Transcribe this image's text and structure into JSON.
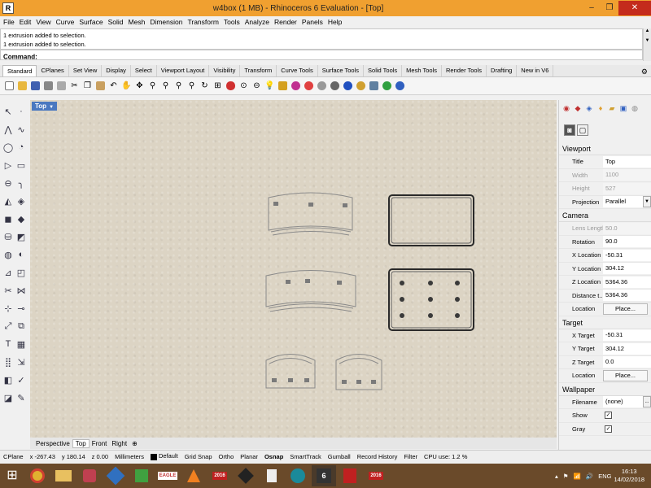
{
  "window": {
    "title": "w4box (1 MB) - Rhinoceros 6 Evaluation - [Top]",
    "minimize_glyph": "–",
    "restore_glyph": "❐",
    "close_glyph": "✕"
  },
  "menu": [
    "File",
    "Edit",
    "View",
    "Curve",
    "Surface",
    "Solid",
    "Mesh",
    "Dimension",
    "Transform",
    "Tools",
    "Analyze",
    "Render",
    "Panels",
    "Help"
  ],
  "command": {
    "history": [
      "1 extrusion added to selection.",
      "1 extrusion added to selection."
    ],
    "prompt": "Command:",
    "value": ""
  },
  "toolbar_tabs": [
    "Standard",
    "CPlanes",
    "Set View",
    "Display",
    "Select",
    "Viewport Layout",
    "Visibility",
    "Transform",
    "Curve Tools",
    "Surface Tools",
    "Solid Tools",
    "Mesh Tools",
    "Render Tools",
    "Drafting",
    "New in V6"
  ],
  "toolbar_icons": [
    "new-file-icon",
    "open-icon",
    "save-icon",
    "print-icon",
    "import-icon",
    "cut-icon",
    "copy-icon",
    "paste-icon",
    "undo-icon",
    "pan-hand-icon",
    "move-icon",
    "zoom-icon",
    "zoom-window-icon",
    "zoom-extents-icon",
    "zoom-selected-icon",
    "rotate-view-icon",
    "four-views-icon",
    "car-icon",
    "cplane-icon",
    "grid-icon",
    "light-icon",
    "lock-icon",
    "materials-icon",
    "render-sphere-icon",
    "shade-icon",
    "rendered-icon",
    "color-sphere-icon",
    "options-gear-icon",
    "layers-icon",
    "globe-icon",
    "help-icon"
  ],
  "viewport": {
    "label": "Top",
    "tabs": [
      "Perspective",
      "Top",
      "Front",
      "Right"
    ],
    "add_tab": "⊕"
  },
  "properties": {
    "viewport_header": "Viewport",
    "viewport": [
      {
        "key": "Title",
        "value": "Top",
        "dim": false
      },
      {
        "key": "Width",
        "value": "1100",
        "dim": true
      },
      {
        "key": "Height",
        "value": "527",
        "dim": true
      },
      {
        "key": "Projection",
        "value": "Parallel",
        "dim": false
      }
    ],
    "camera_header": "Camera",
    "camera": [
      {
        "key": "Lens Length",
        "value": "50.0",
        "dim": true
      },
      {
        "key": "Rotation",
        "value": "90.0",
        "dim": false
      },
      {
        "key": "X Location",
        "value": "-50.31",
        "dim": false
      },
      {
        "key": "Y Location",
        "value": "304.12",
        "dim": false
      },
      {
        "key": "Z Location",
        "value": "5364.36",
        "dim": false
      },
      {
        "key": "Distance t...",
        "value": "5364.36",
        "dim": false
      }
    ],
    "camera_location_label": "Location",
    "camera_location_button": "Place...",
    "target_header": "Target",
    "target": [
      {
        "key": "X Target",
        "value": "-50.31",
        "dim": false
      },
      {
        "key": "Y Target",
        "value": "304.12",
        "dim": false
      },
      {
        "key": "Z Target",
        "value": "0.0",
        "dim": false
      }
    ],
    "target_location_label": "Location",
    "target_location_button": "Place...",
    "wallpaper_header": "Wallpaper",
    "filename_label": "Filename",
    "filename_value": "(none)",
    "filename_button": "...",
    "show_label": "Show",
    "gray_label": "Gray"
  },
  "status": {
    "cplane": "CPlane",
    "x": "x -267.43",
    "y": "y 180.14",
    "z": "z 0.00",
    "units": "Millimeters",
    "layer": "Default",
    "toggles": [
      "Grid Snap",
      "Ortho",
      "Planar",
      "Osnap",
      "SmartTrack",
      "Gumball",
      "Record History",
      "Filter"
    ],
    "cpu": "CPU use: 1.2 %"
  },
  "taskbar": {
    "apps": [
      "chrome",
      "file-explorer",
      "paint",
      "sketchup",
      "maps",
      "eagle",
      "vlc",
      "solidworks-2016",
      "inkscape",
      "calculator",
      "arduino",
      "rhino",
      "acrobat",
      "acrobat-2",
      "solidworks-2016-b"
    ],
    "eagle_label": "EAGLE",
    "sw_label": "2016",
    "lang": "ENG",
    "time": "16:13",
    "date": "14/02/2018"
  },
  "colors": {
    "titlebar": "#f0a030",
    "viewport_bg": "#dcd4c4",
    "viewport_label": "#4a78c0",
    "taskbar": "#6a4a2a"
  }
}
